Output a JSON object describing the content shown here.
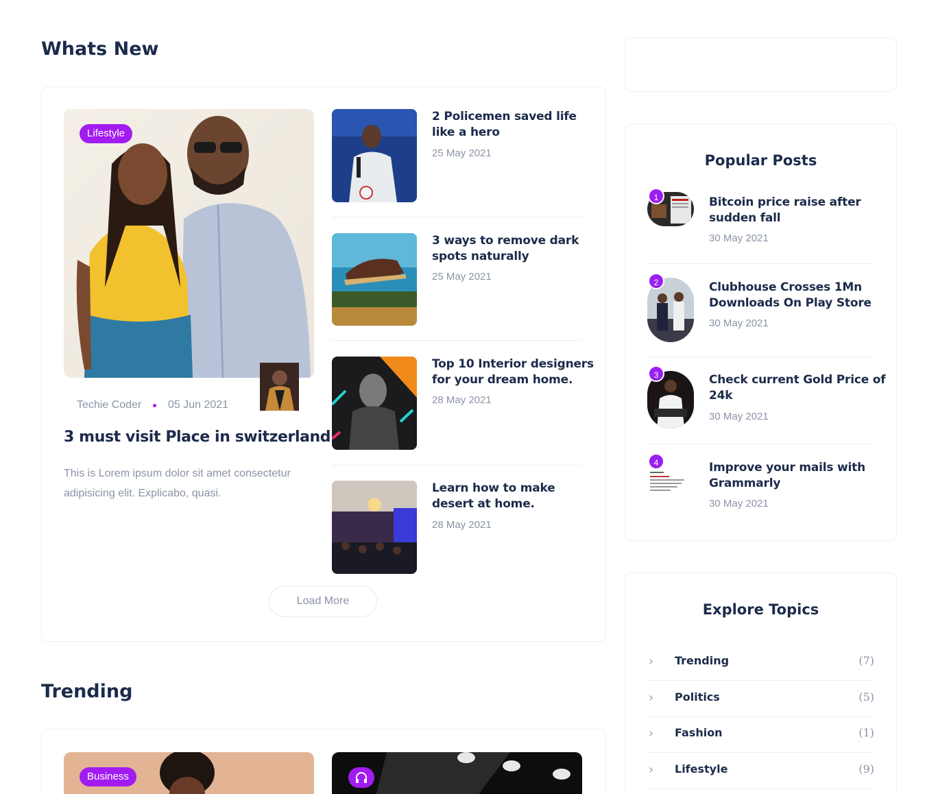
{
  "whats_new": {
    "title": "Whats New",
    "featured": {
      "badge": "Lifestyle",
      "author": "Techie Coder",
      "date": "05 Jun 2021",
      "title": "3 must visit Place in switzerland",
      "excerpt_line1": "This is Lorem ipsum dolor sit amet consectetur",
      "excerpt_line2": "adipisicing elit. Explicabo, quasi."
    },
    "posts": [
      {
        "title_line1": "2 Policemen saved life",
        "title_line2": "like a hero",
        "date": "25 May 2021"
      },
      {
        "title_line1": "3 ways to remove dark",
        "title_line2": "spots naturally",
        "date": "25 May 2021"
      },
      {
        "title_line1": "Top 10 Interior designers",
        "title_line2": "for your dream home.",
        "date": "28 May 2021"
      },
      {
        "title_line1": "Learn how to make",
        "title_line2": "desert at home.",
        "date": "28 May 2021"
      }
    ],
    "load_more": "Load More"
  },
  "trending": {
    "title": "Trending",
    "badge": "Business"
  },
  "popular_posts": {
    "title": "Popular Posts",
    "items": [
      {
        "num": "1",
        "title_line1": "Bitcoin price raise after",
        "title_line2": "sudden fall",
        "date": "30 May 2021"
      },
      {
        "num": "2",
        "title_line1": "Clubhouse Crosses 1Mn",
        "title_line2": "Downloads On Play Store",
        "date": "30 May 2021"
      },
      {
        "num": "3",
        "title_line1": "Check current Gold Price of",
        "title_line2": "24k",
        "date": "30 May 2021"
      },
      {
        "num": "4",
        "title_line1": "Improve your mails with",
        "title_line2": "Grammarly",
        "date": "30 May 2021"
      }
    ]
  },
  "explore_topics": {
    "title": "Explore Topics",
    "items": [
      {
        "name": "Trending",
        "count": "(7)"
      },
      {
        "name": "Politics",
        "count": "(5)"
      },
      {
        "name": "Fashion",
        "count": "(1)"
      },
      {
        "name": "Lifestyle",
        "count": "(9)"
      }
    ]
  },
  "colors": {
    "accent": "#a21cf0",
    "heading": "#1c2b4b",
    "muted": "#8a94a6",
    "border": "#eef0f4"
  }
}
